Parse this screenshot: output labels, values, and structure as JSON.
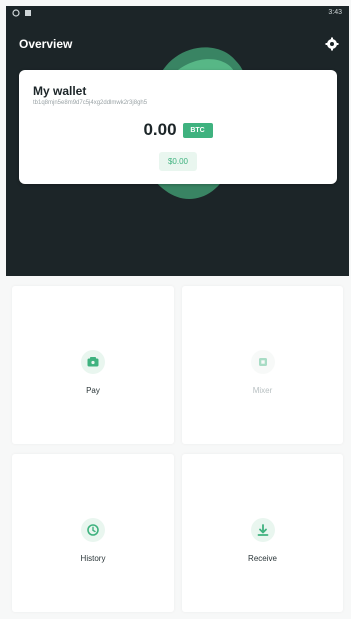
{
  "status_bar": {
    "time": "3:43"
  },
  "app": {
    "title": "Overview"
  },
  "wallet": {
    "title": "My wallet",
    "address": "tb1q8mjn5e8m9d7c5j4xg2ddlmwk2r3j8gh5",
    "balance": "0.00",
    "currency": "BTC",
    "fiat_balance": "$0.00"
  },
  "actions": {
    "pay": {
      "label": "Pay"
    },
    "mixer": {
      "label": "Mixer"
    },
    "history": {
      "label": "History"
    },
    "receive": {
      "label": "Receive"
    }
  },
  "colors": {
    "header_bg": "#1c2528",
    "accent": "#3fb27f",
    "accent_light": "#e9f6ef"
  },
  "icons": {
    "settings": "gear-icon",
    "pay": "wallet-icon",
    "mixer": "mixer-icon",
    "history": "history-icon",
    "receive": "download-icon"
  }
}
